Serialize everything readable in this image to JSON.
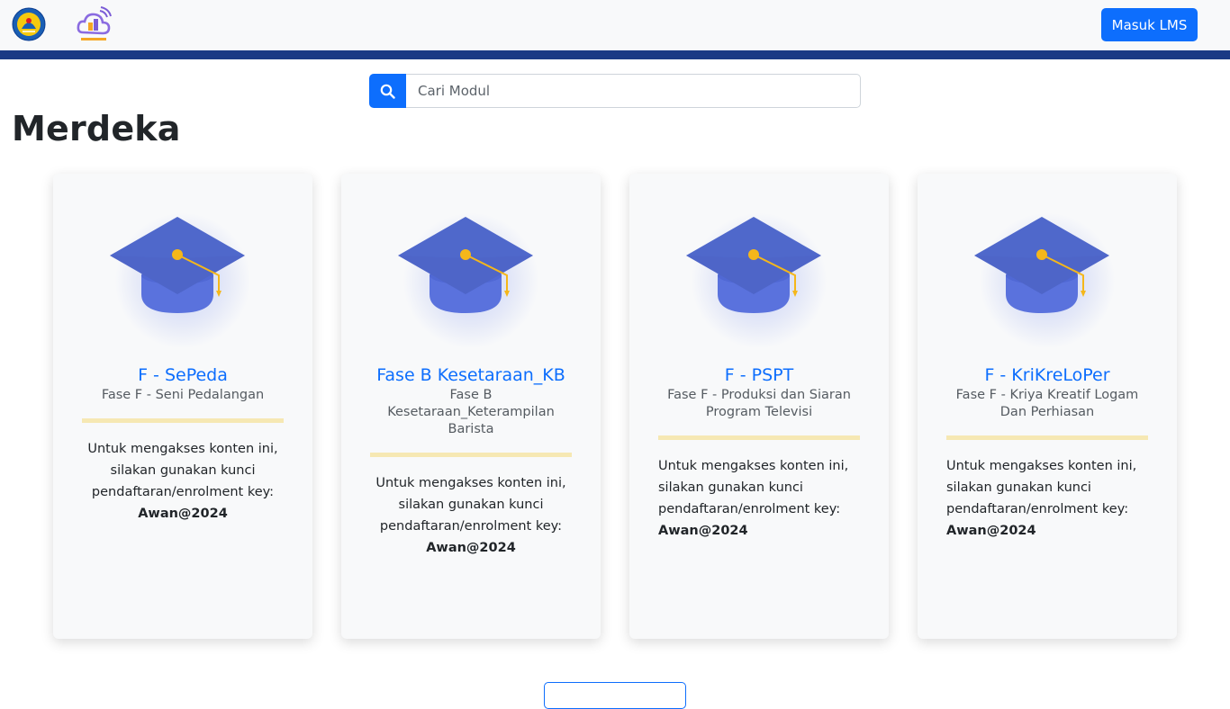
{
  "header": {
    "logo_left": "tut-wuri-handayani-logo",
    "logo_right": "awan-cloud-logo",
    "login_button": "Masuk LMS"
  },
  "search": {
    "placeholder": "Cari Modul",
    "value": "",
    "icon": "search-icon"
  },
  "page": {
    "title": "Merdeka"
  },
  "courses": [
    {
      "title": "F - SePeda",
      "subtitle": "Fase F - Seni Pedalangan",
      "desc": "Untuk mengakses konten ini, silakan gunakan kunci pendaftaran/enrolment key:",
      "key": "Awan@2024",
      "align": "center"
    },
    {
      "title": "Fase B Kesetaraan_KB",
      "subtitle": "Fase B Kesetaraan_Keterampilan Barista",
      "desc": "Untuk mengakses konten ini, silakan gunakan kunci pendaftaran/enrolment key:",
      "key": "Awan@2024",
      "align": "center"
    },
    {
      "title": "F - PSPT",
      "subtitle": "Fase F - Produksi dan Siaran Program Televisi",
      "desc": "Untuk mengakses konten ini, silakan gunakan kunci pendaftaran/enrolment key:",
      "key": "Awan@2024",
      "align": "left"
    },
    {
      "title": "F - KriKreLoPer",
      "subtitle": "Fase F - Kriya Kreatif Logam Dan Perhiasan",
      "desc": "Untuk mengakses konten ini, silakan gunakan kunci pendaftaran/enrolment key:",
      "key": "Awan@2024",
      "align": "left"
    }
  ],
  "colors": {
    "primary": "#0d6efd",
    "stripe": "#1b3a85",
    "divider": "#f6e8b3",
    "cap": "#5064cc"
  }
}
